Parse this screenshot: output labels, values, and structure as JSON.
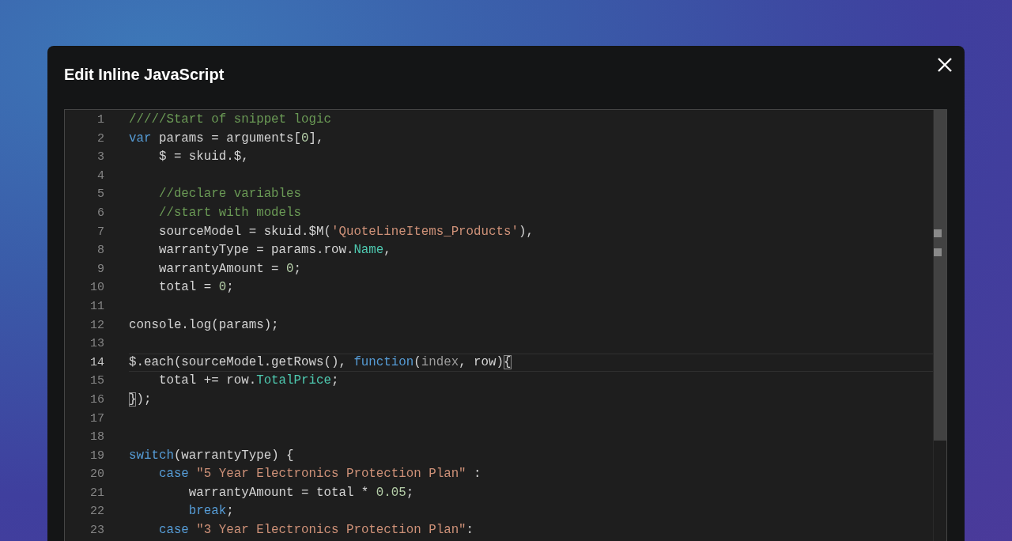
{
  "dialog": {
    "title": "Edit Inline JavaScript"
  },
  "editor": {
    "lines": [
      {
        "number": "1",
        "current": false,
        "tokens": [
          {
            "kind": "comment",
            "text": "/////Start of snippet logic"
          }
        ]
      },
      {
        "number": "2",
        "current": false,
        "tokens": [
          {
            "kind": "keyword",
            "text": "var"
          },
          {
            "kind": "plain",
            "text": " params = arguments["
          },
          {
            "kind": "number",
            "text": "0"
          },
          {
            "kind": "plain",
            "text": "],"
          }
        ]
      },
      {
        "number": "3",
        "current": false,
        "tokens": [
          {
            "kind": "plain",
            "text": "    $ = skuid.$,"
          }
        ]
      },
      {
        "number": "4",
        "current": false
      },
      {
        "number": "5",
        "current": false,
        "tokens": [
          {
            "kind": "comment",
            "text": "    //declare variables"
          }
        ]
      },
      {
        "number": "6",
        "current": false,
        "tokens": [
          {
            "kind": "comment",
            "text": "    //start with models"
          }
        ]
      },
      {
        "number": "7",
        "current": false,
        "tokens": [
          {
            "kind": "plain",
            "text": "    sourceModel = skuid.$M("
          },
          {
            "kind": "string",
            "text": "'QuoteLineItems_Products'"
          },
          {
            "kind": "plain",
            "text": "),"
          }
        ]
      },
      {
        "number": "8",
        "current": false,
        "tokens": [
          {
            "kind": "plain",
            "text": "    warrantyType = params.row."
          },
          {
            "kind": "property",
            "text": "Name"
          },
          {
            "kind": "plain",
            "text": ","
          }
        ]
      },
      {
        "number": "9",
        "current": false,
        "tokens": [
          {
            "kind": "plain",
            "text": "    warrantyAmount = "
          },
          {
            "kind": "number",
            "text": "0"
          },
          {
            "kind": "plain",
            "text": ";"
          }
        ]
      },
      {
        "number": "10",
        "current": false,
        "tokens": [
          {
            "kind": "plain",
            "text": "    total = "
          },
          {
            "kind": "number",
            "text": "0"
          },
          {
            "kind": "plain",
            "text": ";"
          }
        ]
      },
      {
        "number": "11",
        "current": false
      },
      {
        "number": "12",
        "current": false,
        "tokens": [
          {
            "kind": "plain",
            "text": "console.log(params);"
          }
        ]
      },
      {
        "number": "13",
        "current": false
      },
      {
        "number": "14",
        "current": true,
        "tokens": [
          {
            "kind": "plain",
            "text": "$.each(sourceModel.getRows(), "
          },
          {
            "kind": "keyword",
            "text": "function"
          },
          {
            "kind": "plain",
            "text": "("
          },
          {
            "kind": "param",
            "text": "index"
          },
          {
            "kind": "plain",
            "text": ", row)"
          },
          {
            "kind": "bracket",
            "text": "{"
          }
        ]
      },
      {
        "number": "15",
        "current": false,
        "tokens": [
          {
            "kind": "plain",
            "text": "    total += row."
          },
          {
            "kind": "property",
            "text": "TotalPrice"
          },
          {
            "kind": "plain",
            "text": ";"
          }
        ]
      },
      {
        "number": "16",
        "current": false,
        "tokens": [
          {
            "kind": "bracket",
            "text": "}"
          },
          {
            "kind": "plain",
            "text": ");"
          }
        ]
      },
      {
        "number": "17",
        "current": false
      },
      {
        "number": "18",
        "current": false
      },
      {
        "number": "19",
        "current": false,
        "tokens": [
          {
            "kind": "keyword",
            "text": "switch"
          },
          {
            "kind": "plain",
            "text": "(warrantyType) {"
          }
        ]
      },
      {
        "number": "20",
        "current": false,
        "tokens": [
          {
            "kind": "keyword",
            "text": "    case "
          },
          {
            "kind": "string",
            "text": "\"5 Year Electronics Protection Plan\""
          },
          {
            "kind": "plain",
            "text": " :"
          }
        ]
      },
      {
        "number": "21",
        "current": false,
        "tokens": [
          {
            "kind": "plain",
            "text": "        warrantyAmount = total * "
          },
          {
            "kind": "number",
            "text": "0.05"
          },
          {
            "kind": "plain",
            "text": ";"
          }
        ]
      },
      {
        "number": "22",
        "current": false,
        "tokens": [
          {
            "kind": "keyword",
            "text": "        break"
          },
          {
            "kind": "plain",
            "text": ";"
          }
        ]
      },
      {
        "number": "23",
        "current": false,
        "tokens": [
          {
            "kind": "keyword",
            "text": "    case "
          },
          {
            "kind": "string",
            "text": "\"3 Year Electronics Protection Plan\""
          },
          {
            "kind": "plain",
            "text": ":"
          }
        ]
      }
    ]
  }
}
